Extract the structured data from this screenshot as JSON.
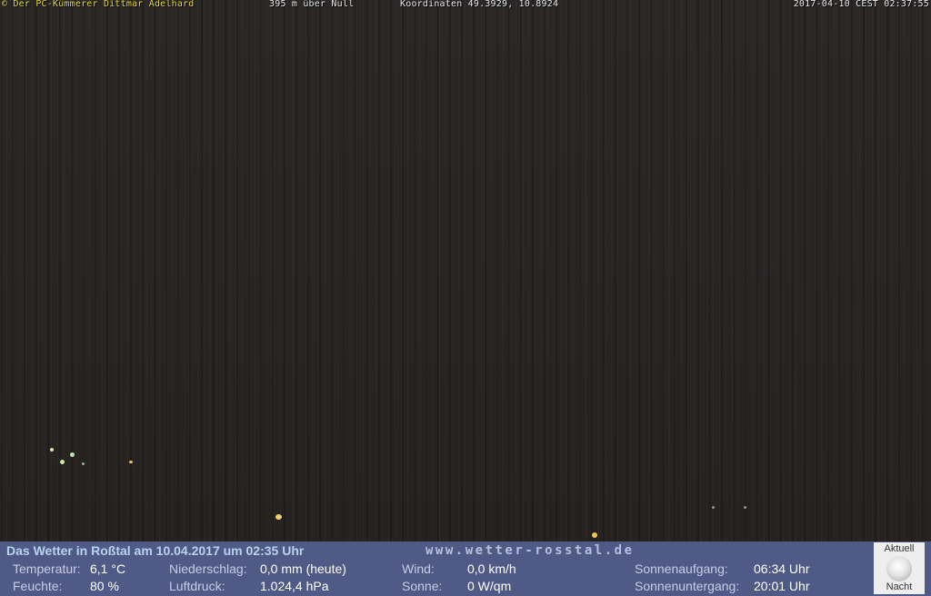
{
  "overlay": {
    "credit": "© Der PC-Kümmerer Dittmar Adelhard",
    "altitude": "395 m über Null",
    "coordinates": "Koordinaten 49.3929, 10.8924",
    "datetime": "2017-04-10 CEST 02:37:55"
  },
  "weather": {
    "title": "Das Wetter in Roßtal am 10.04.2017 um 02:35 Uhr",
    "url": "www.wetter-rosstal.de",
    "temperature_label": "Temperatur:",
    "temperature_value": "6,1 °C",
    "humidity_label": "Feuchte:",
    "humidity_value": "80 %",
    "precip_label": "Niederschlag:",
    "precip_value": "0,0 mm (heute)",
    "pressure_label": "Luftdruck:",
    "pressure_value": "1.024,4 hPa",
    "wind_label": "Wind:",
    "wind_value": "0,0 km/h",
    "sun_label": "Sonne:",
    "sun_value": "0 W/qm",
    "sunrise_label": "Sonnenaufgang:",
    "sunrise_value": "06:34 Uhr",
    "sunset_label": "Sonnenuntergang:",
    "sunset_value": "20:01 Uhr"
  },
  "moon": {
    "top_label": "Aktuell",
    "bottom_label": "Nacht",
    "icon": "full-moon-icon"
  },
  "colors": {
    "bar_background": "#4f5a86",
    "title_color": "#b7d3ee",
    "credit_color": "#e8d830"
  }
}
